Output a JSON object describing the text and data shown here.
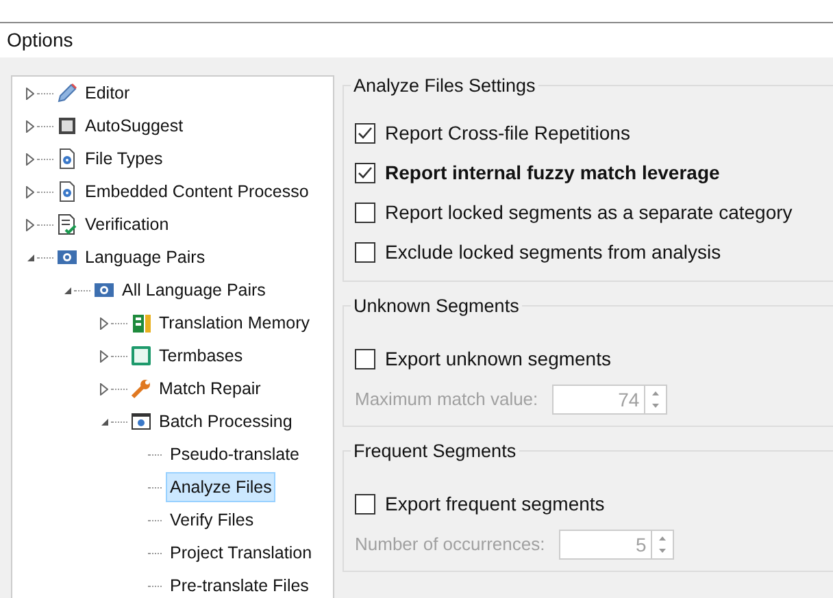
{
  "window": {
    "title": "Options"
  },
  "tree": [
    {
      "label": "Editor",
      "kind": "pencil",
      "expanded": false,
      "selected": false
    },
    {
      "label": "AutoSuggest",
      "kind": "suggest",
      "expanded": false,
      "selected": false
    },
    {
      "label": "File Types",
      "kind": "filegear",
      "expanded": false,
      "selected": false
    },
    {
      "label": "Embedded Content Processo",
      "kind": "filegear",
      "expanded": false,
      "selected": false
    },
    {
      "label": "Verification",
      "kind": "verify",
      "expanded": false,
      "selected": false
    },
    {
      "label": "Language Pairs",
      "kind": "language",
      "expanded": true,
      "selected": false,
      "children": [
        {
          "label": "All Language Pairs",
          "kind": "language",
          "expanded": true,
          "selected": false,
          "children": [
            {
              "label": "Translation Memory",
              "kind": "memory",
              "expanded": false,
              "selected": false
            },
            {
              "label": "Termbases",
              "kind": "termbase",
              "expanded": false,
              "selected": false
            },
            {
              "label": "Match Repair",
              "kind": "wrench",
              "expanded": false,
              "selected": false
            },
            {
              "label": "Batch Processing",
              "kind": "batch",
              "expanded": true,
              "selected": false,
              "children": [
                {
                  "label": "Pseudo-translate",
                  "selected": false
                },
                {
                  "label": "Analyze Files",
                  "selected": true
                },
                {
                  "label": "Verify Files",
                  "selected": false
                },
                {
                  "label": "Project Translation",
                  "selected": false
                },
                {
                  "label": "Pre-translate Files",
                  "selected": false
                }
              ]
            }
          ]
        }
      ]
    }
  ],
  "groups": [
    {
      "title": "Analyze Files Settings",
      "checkboxes": [
        {
          "label": "Report Cross-file Repetitions",
          "checked": true,
          "bold": false
        },
        {
          "label": "Report internal fuzzy match leverage",
          "checked": true,
          "bold": true
        },
        {
          "label": "Report locked segments as a separate category",
          "checked": false,
          "bold": false
        },
        {
          "label": "Exclude locked segments from analysis",
          "checked": false,
          "bold": false
        }
      ]
    },
    {
      "title": "Unknown Segments",
      "checkboxes": [
        {
          "label": "Export unknown segments",
          "checked": false,
          "bold": false
        }
      ],
      "spinner": {
        "label": "Maximum match value:",
        "value": "74",
        "disabled": true
      }
    },
    {
      "title": "Frequent Segments",
      "checkboxes": [
        {
          "label": "Export frequent segments",
          "checked": false,
          "bold": false
        }
      ],
      "spinner": {
        "label": "Number of occurrences:",
        "value": "5",
        "disabled": true
      }
    }
  ]
}
